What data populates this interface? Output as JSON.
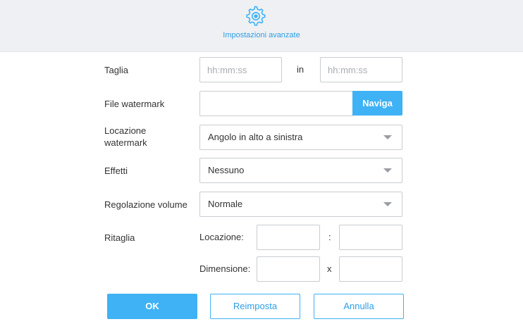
{
  "header": {
    "icon": "gear-icon",
    "title": "Impostazioni avanzate",
    "accent_color": "#3eb2f5"
  },
  "trim": {
    "label": "Taglia",
    "start_placeholder": "hh:mm:ss",
    "separator": "in",
    "end_placeholder": "hh:mm:ss"
  },
  "watermark_file": {
    "label": "File watermark",
    "value": "",
    "browse_label": "Naviga"
  },
  "watermark_location": {
    "label": "Locazione watermark",
    "selected": "Angolo in alto a sinistra"
  },
  "effects": {
    "label": "Effetti",
    "selected": "Nessuno"
  },
  "volume": {
    "label": "Regolazione volume",
    "selected": "Normale"
  },
  "crop": {
    "label": "Ritaglia",
    "location_label": "Locazione:",
    "location_separator": ":",
    "size_label": "Dimensione:",
    "size_separator": "x"
  },
  "actions": {
    "ok_label": "OK",
    "reset_label": "Reimposta",
    "cancel_label": "Annulla"
  }
}
